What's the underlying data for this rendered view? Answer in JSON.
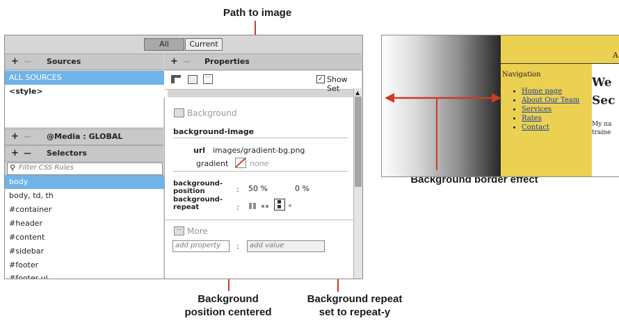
{
  "callouts": {
    "path_to_image": "Path to image",
    "background_border_effect": "Background border effect",
    "bg_position_line1": "Background",
    "bg_position_line2": "position centered",
    "bg_repeat_line1": "Background repeat",
    "bg_repeat_line2": "set to repeat-y"
  },
  "panel": {
    "tabs": {
      "all": "All",
      "current": "Current"
    },
    "sources": {
      "title": "Sources",
      "items": [
        "ALL SOURCES",
        "<style>"
      ]
    },
    "media": {
      "title": "@Media : GLOBAL"
    },
    "selectors": {
      "title": "Selectors",
      "filter_placeholder": "Filter CSS Rules",
      "items": [
        "body",
        "body, td, th",
        "#container",
        "#header",
        "#content",
        "#sidebar",
        "#footer",
        "#footer ul"
      ]
    },
    "properties": {
      "title": "Properties",
      "show_set": "Show Set",
      "show_set_checked": true,
      "background_section": "Background",
      "background_image_label": "background-image",
      "url_label": "url",
      "url_value": "images/gradient-bg.png",
      "gradient_label": "gradient",
      "gradient_value": "none",
      "bg_position_label_1": "background-",
      "bg_position_label_2": "position",
      "bg_position_x": "50 %",
      "bg_position_y": "0 %",
      "bg_repeat_label_1": "background-",
      "bg_repeat_label_2": "repeat",
      "colon": ":",
      "more_section": "More",
      "add_property": "add property",
      "add_value": "add value"
    }
  },
  "preview": {
    "header_text": "A",
    "nav_heading": "Navigation",
    "nav_links": [
      "Home page",
      "About Our Team",
      "Services",
      "Rates",
      "Contact"
    ],
    "content_heading_1": "We",
    "content_heading_2": "Sec",
    "content_text_1": "My na",
    "content_text_2": "traine"
  },
  "colors": {
    "accent_red": "#cc3b23",
    "selection_blue": "#6fb3e8",
    "preview_yellow": "#ecd052"
  }
}
